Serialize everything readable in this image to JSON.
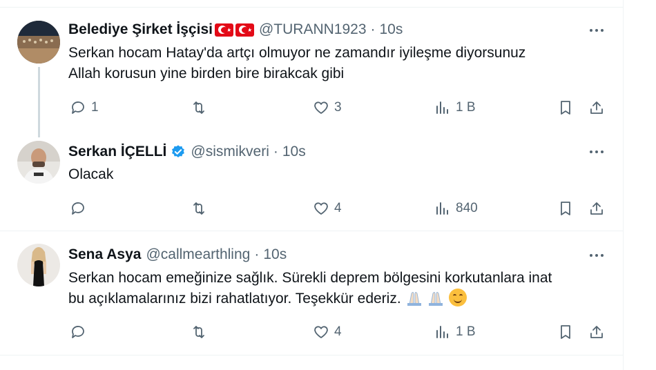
{
  "tweets": [
    {
      "name": "Belediye Şirket İşçisi",
      "flags": [
        "turkey-flag",
        "turkey-flag"
      ],
      "handle": "@TURANN1923",
      "dot": "·",
      "time": "10s",
      "text_lines": [
        "Serkan hocam Hatay'da artçı olmuyor ne zamandır iyileşme  diyorsunuz",
        "Allah korusun yine birden bire birakcak  gibi"
      ],
      "replies": "1",
      "retweets": "",
      "likes": "3",
      "views": "1 B"
    },
    {
      "name": "Serkan İÇELLİ",
      "verified": true,
      "handle": "@sismikveri",
      "dot": "·",
      "time": "10s",
      "text_lines": [
        "Olacak"
      ],
      "replies": "",
      "retweets": "",
      "likes": "4",
      "views": "840"
    },
    {
      "name": "Sena Asya",
      "handle": "@callmearthling",
      "dot": "·",
      "time": "10s",
      "text_lines": [
        "Serkan hocam emeğinize sağlık. Sürekli deprem bölgesini korkutanlara inat",
        "bu açıklamalarınız bizi rahatlatıyor. Teşekkür ederiz."
      ],
      "emojis": [
        "folded-hands-light-skin",
        "folded-hands-light-skin",
        "smiling-face"
      ],
      "replies": "",
      "retweets": "",
      "likes": "4",
      "views": "1 B"
    }
  ],
  "colors": {
    "text": "#0f1419",
    "secondary": "#536471",
    "verified": "#1d9bf0",
    "thread_line": "#cfd9de",
    "divider": "#eff3f4"
  }
}
